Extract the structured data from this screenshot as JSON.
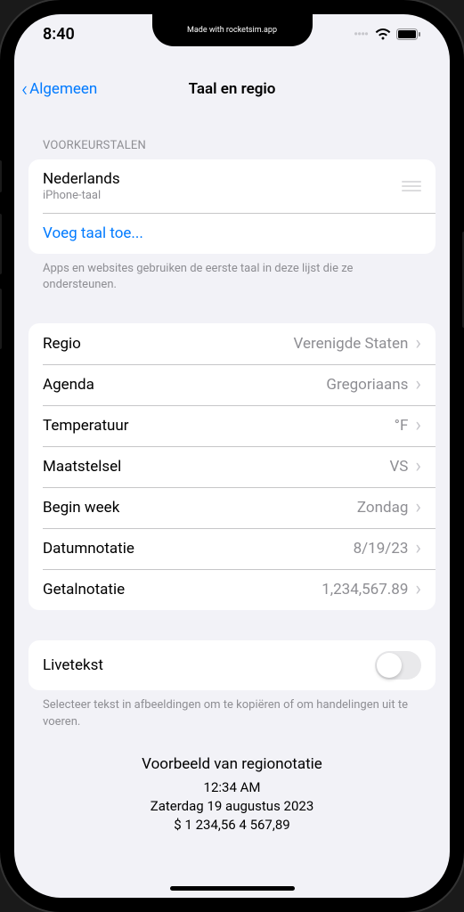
{
  "watermark": "Made with rocketsim.app",
  "statusBar": {
    "time": "8:40"
  },
  "nav": {
    "back": "Algemeen",
    "title": "Taal en regio"
  },
  "languages": {
    "header": "VOORKEURSTALEN",
    "primary": {
      "name": "Nederlands",
      "subtitle": "iPhone-taal"
    },
    "addLink": "Voeg taal toe...",
    "footer": "Apps en websites gebruiken de eerste taal in deze lijst die ze ondersteunen."
  },
  "settings": [
    {
      "label": "Regio",
      "value": "Verenigde Staten"
    },
    {
      "label": "Agenda",
      "value": "Gregoriaans"
    },
    {
      "label": "Temperatuur",
      "value": "°F"
    },
    {
      "label": "Maatstelsel",
      "value": "VS"
    },
    {
      "label": "Begin week",
      "value": "Zondag"
    },
    {
      "label": "Datumnotatie",
      "value": "8/19/23"
    },
    {
      "label": "Getalnotatie",
      "value": "1,234,567.89"
    }
  ],
  "liveText": {
    "label": "Livetekst",
    "footer": "Selecteer tekst in afbeeldingen om te kopiëren of om handelingen uit te voeren."
  },
  "preview": {
    "title": "Voorbeeld van regionotatie",
    "line1": "12:34 AM",
    "line2": "Zaterdag 19 augustus 2023",
    "line3": "$ 1 234,56    4 567,89"
  }
}
